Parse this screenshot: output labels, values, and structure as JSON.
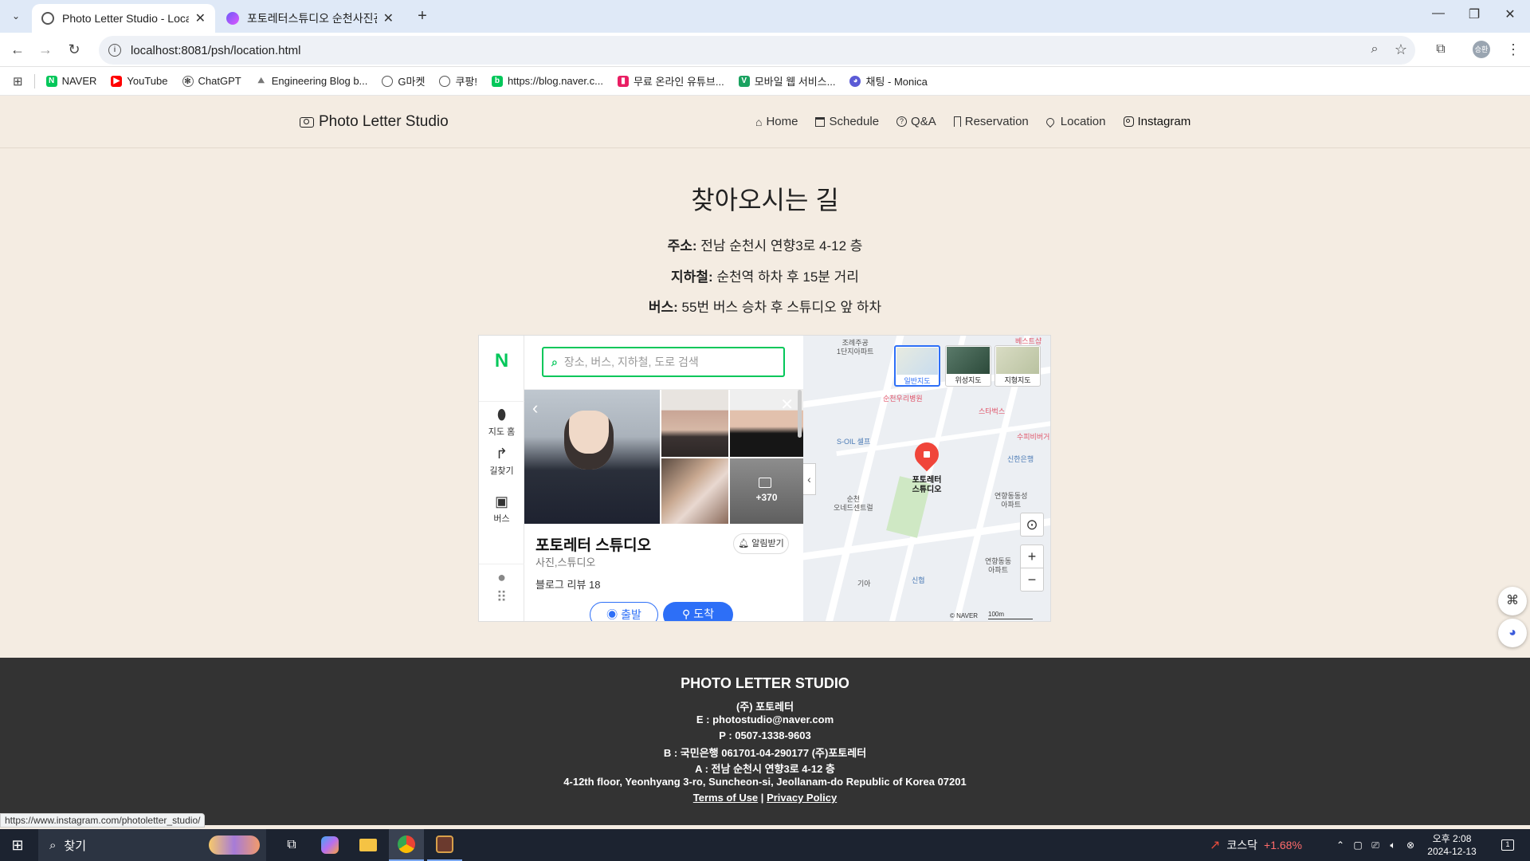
{
  "browser": {
    "tabs": [
      {
        "title": "Photo Letter Studio - Location",
        "active": true
      },
      {
        "title": "포토레터스튜디오 순천사진관",
        "active": false
      }
    ],
    "new_tab": "+",
    "url": "localhost:8081/psh/location.html",
    "bookmarks": [
      {
        "label": "NAVER",
        "icon": "naver-icon",
        "color": "#03c75a"
      },
      {
        "label": "YouTube",
        "icon": "youtube-icon",
        "color": "#ff0000"
      },
      {
        "label": "ChatGPT",
        "icon": "chatgpt-icon",
        "color": "#444444"
      },
      {
        "label": "Engineering Blog b...",
        "icon": "blog-icon",
        "color": "#888888"
      },
      {
        "label": "G마켓",
        "icon": "globe-icon",
        "color": "#555555"
      },
      {
        "label": "쿠팡!",
        "icon": "globe-icon",
        "color": "#555555"
      },
      {
        "label": "https://blog.naver.c...",
        "icon": "naver-blog-icon",
        "color": "#03c75a"
      },
      {
        "label": "무료 온라인 유튜브...",
        "icon": "bookmark-icon",
        "color": "#e91e63"
      },
      {
        "label": "모바일 웹 서비스...",
        "icon": "v-icon",
        "color": "#1aa260"
      },
      {
        "label": "채팅 - Monica",
        "icon": "monica-icon",
        "color": "#5b5bd6"
      }
    ]
  },
  "site": {
    "brand": "Photo Letter Studio",
    "nav": [
      {
        "label": "Home",
        "icon": "home-icon",
        "glyph": "⌂"
      },
      {
        "label": "Schedule",
        "icon": "calendar-icon",
        "glyph": "▭"
      },
      {
        "label": "Q&A",
        "icon": "question-icon",
        "glyph": "?"
      },
      {
        "label": "Reservation",
        "icon": "bookmark-icon",
        "glyph": "⊓"
      },
      {
        "label": "Location",
        "icon": "location-pin-icon",
        "glyph": "⚲"
      },
      {
        "label": "Instagram",
        "icon": "instagram-icon",
        "glyph": "◙"
      }
    ]
  },
  "main": {
    "title": "찾아오시는 길",
    "address_label": "주소:",
    "address_value": "전남 순천시 연향3로 4-12 층",
    "subway_label": "지하철:",
    "subway_value": "순천역 하차 후 15분 거리",
    "bus_label": "버스:",
    "bus_value": "55번 버스 승차 후 스튜디오 앞 하차"
  },
  "map_widget": {
    "logo": "N",
    "search_placeholder": "장소, 버스, 지하철, 도로 검색",
    "left_nav": [
      {
        "label": "지도 홈",
        "icon": "map-home-icon"
      },
      {
        "label": "길찾기",
        "icon": "directions-icon"
      },
      {
        "label": "버스",
        "icon": "bus-icon"
      }
    ],
    "photo_count": "+370",
    "place_name": "포토레터 스튜디오",
    "place_category": "사진,스튜디오",
    "place_reviews": "블로그 리뷰 18",
    "alarm_button": "알림받기",
    "start_button": "출발",
    "arrive_button": "도착",
    "layers": [
      "일반지도",
      "위성지도",
      "지형지도"
    ],
    "marker_label_1": "포토레터",
    "marker_label_2": "스튜디오",
    "map_labels": {
      "l1": "조례주공",
      "l2": "1단지아파트",
      "l3": "순천우리병원",
      "l4": "스타벅스",
      "l5": "S-OIL 셀프",
      "l6": "신한은행",
      "l7": "순천",
      "l8": "오네드센트럴",
      "l9": "연향동동성",
      "l10": "아파트",
      "l11": "연향동동",
      "l12": "아파트",
      "l13": "기아",
      "l14": "신협",
      "l15": "수피비버거",
      "l16": "베스트샵"
    },
    "copyright": "© NAVER",
    "scale": "100m"
  },
  "footer": {
    "title": "PHOTO LETTER STUDIO",
    "company": "(주) 포토레터",
    "email": "E : photostudio@naver.com",
    "phone": "P : 0507-1338-9603",
    "bank": "B : 국민은행 061701-04-290177 (주)포토레터",
    "address_kr": "A : 전남 순천시 연향3로 4-12 층",
    "address_en": "4-12th floor, Yeonhyang 3-ro, Suncheon-si, Jeollanam-do Republic of Korea 07201",
    "terms": "Terms of Use",
    "separator": "|",
    "privacy": "Privacy Policy"
  },
  "status_url": "https://www.instagram.com/photoletter_studio/",
  "taskbar": {
    "search": "찾기",
    "stock_name": "코스닥",
    "stock_change": "+1.68%",
    "time": "오후 2:08",
    "date": "2024-12-13",
    "notification_count": "1"
  }
}
